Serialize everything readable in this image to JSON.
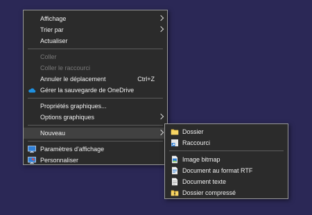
{
  "context_menu": {
    "items": [
      {
        "label": "Affichage"
      },
      {
        "label": "Trier par"
      },
      {
        "label": "Actualiser"
      },
      {
        "label": "Coller"
      },
      {
        "label": "Coller le raccourci"
      },
      {
        "label": "Annuler le déplacement",
        "shortcut": "Ctrl+Z"
      },
      {
        "label": "Gérer la sauvegarde de OneDrive",
        "icon": "onedrive-cloud-icon"
      },
      {
        "label": "Propriétés graphiques..."
      },
      {
        "label": "Options graphiques"
      },
      {
        "label": "Nouveau"
      },
      {
        "label": "Paramètres d'affichage",
        "icon": "display-settings-icon"
      },
      {
        "label": "Personnaliser",
        "icon": "personalize-icon"
      }
    ]
  },
  "submenu_new": {
    "items": [
      {
        "label": "Dossier",
        "icon": "folder-icon"
      },
      {
        "label": "Raccourci",
        "icon": "shortcut-icon"
      },
      {
        "label": "Image bitmap",
        "icon": "bitmap-image-icon"
      },
      {
        "label": "Document au format RTF",
        "icon": "rtf-document-icon"
      },
      {
        "label": "Document texte",
        "icon": "text-document-icon"
      },
      {
        "label": "Dossier compressé",
        "icon": "zip-folder-icon"
      }
    ]
  },
  "colors": {
    "desktop": "#2b2856",
    "menu_bg": "#2b2b2b",
    "menu_border": "#9a9a9a",
    "highlight": "#414141",
    "disabled_text": "#7a7a7a",
    "folder": "#f2c84b",
    "onedrive": "#1e90e0"
  }
}
